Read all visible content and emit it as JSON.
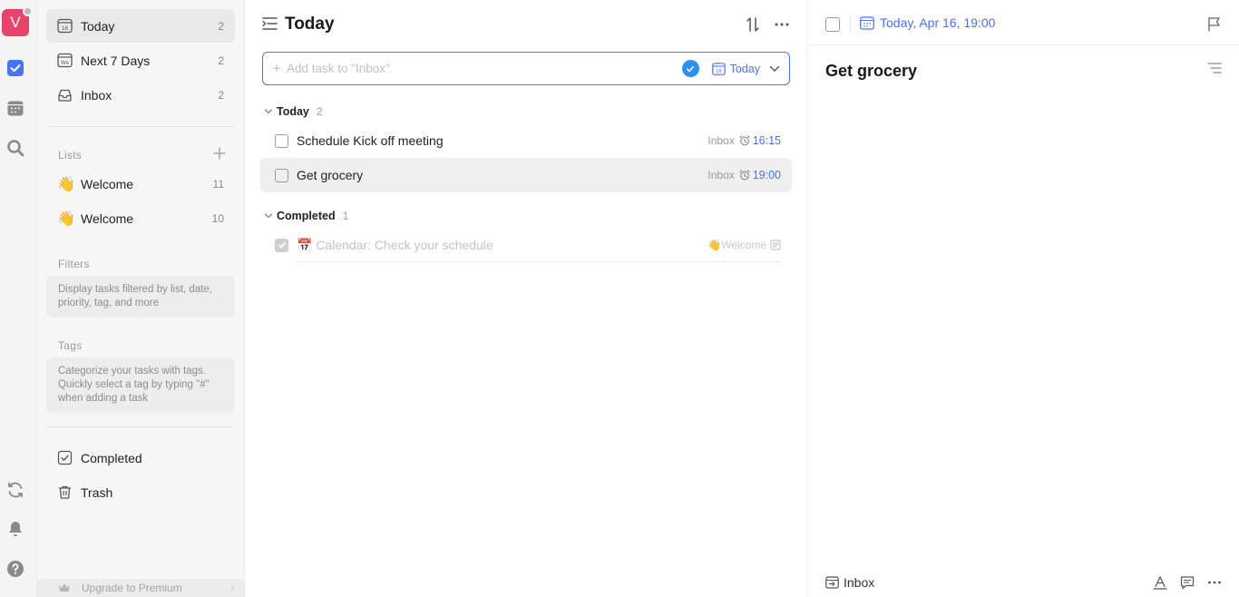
{
  "rail": {
    "avatar_letter": "V",
    "colors": {
      "avatar": "#e8436b",
      "accent": "#4772fa"
    }
  },
  "sidebar": {
    "smart_lists": [
      {
        "label": "Today",
        "count": "2",
        "icon": "calendar-16-icon",
        "cal_num": "16"
      },
      {
        "label": "Next 7 Days",
        "count": "2",
        "icon": "calendar-week-icon",
        "cal_num": "We"
      },
      {
        "label": "Inbox",
        "count": "2",
        "icon": "inbox-icon"
      }
    ],
    "lists_title": "Lists",
    "lists": [
      {
        "emoji": "👋",
        "label": "Welcome",
        "count": "11"
      },
      {
        "emoji": "👋",
        "label": "Welcome",
        "count": "10"
      }
    ],
    "filters_title": "Filters",
    "filters_hint": "Display tasks filtered by list, date, priority, tag, and more",
    "tags_title": "Tags",
    "tags_hint": "Categorize your tasks with tags. Quickly select a tag by typing \"#\" when adding a task",
    "completed_label": "Completed",
    "trash_label": "Trash",
    "upgrade_label": "Upgrade to Premium"
  },
  "main": {
    "title": "Today",
    "add_task_placeholder": "Add task to \"Inbox\"",
    "add_task_date": "Today",
    "add_task_cal_num": "16",
    "groups": {
      "today": {
        "label": "Today",
        "count": "2"
      },
      "completed": {
        "label": "Completed",
        "count": "1"
      }
    },
    "tasks": [
      {
        "title": "Schedule Kick off meeting",
        "list": "Inbox",
        "time": "16:15"
      },
      {
        "title": "Get grocery",
        "list": "Inbox",
        "time": "19:00"
      }
    ],
    "completed_tasks": [
      {
        "title": "📅 Calendar: Check your schedule",
        "list": "👋Welcome"
      }
    ]
  },
  "detail": {
    "date_label": "Today, Apr 16, 19:00",
    "title": "Get grocery",
    "list_label": "Inbox"
  }
}
